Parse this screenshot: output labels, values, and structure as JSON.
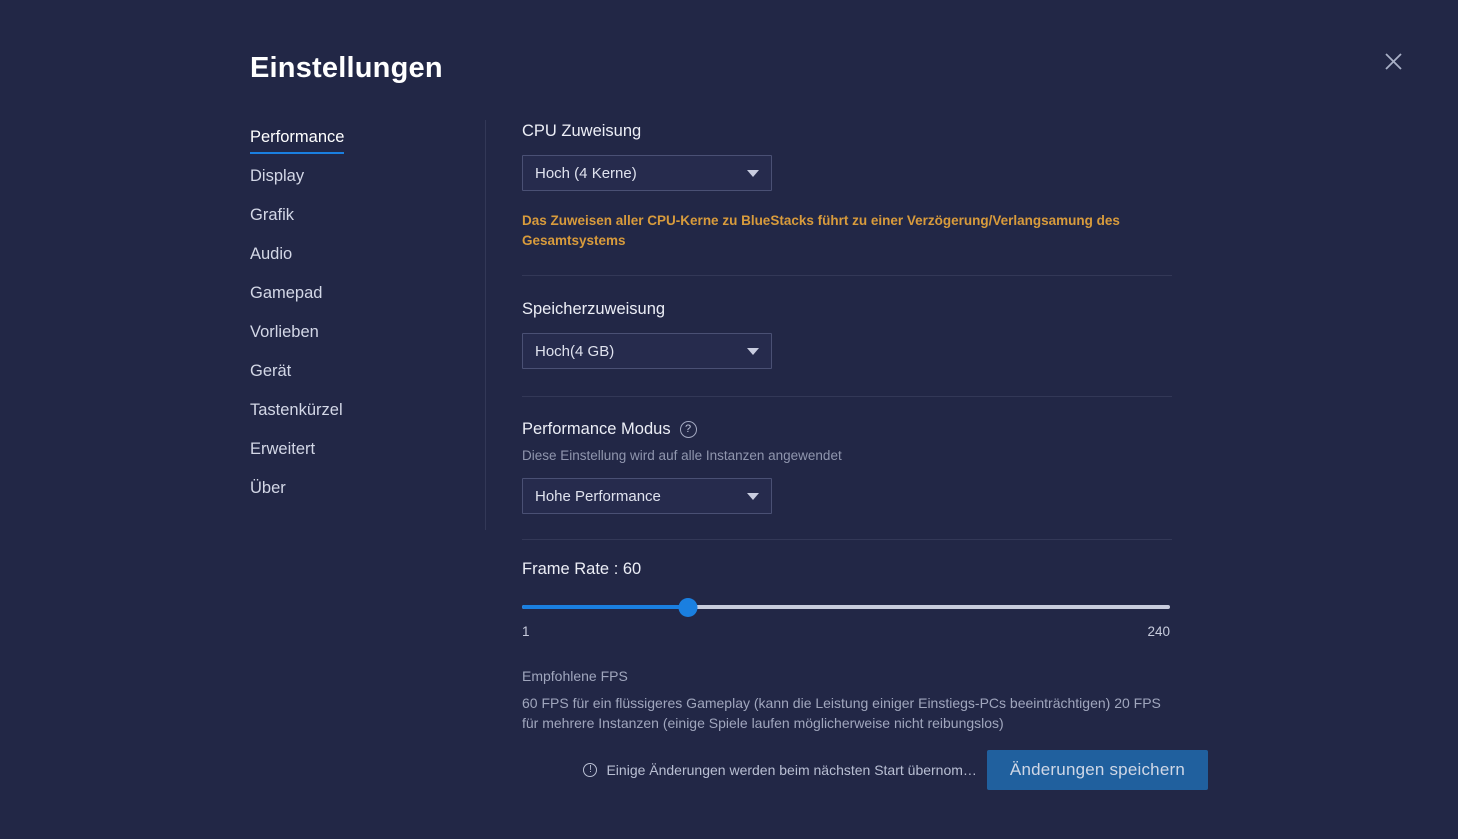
{
  "window": {
    "title": "Einstellungen",
    "close_icon": "close-icon"
  },
  "sidebar": {
    "items": [
      {
        "label": "Performance",
        "active": true
      },
      {
        "label": "Display",
        "active": false
      },
      {
        "label": "Grafik",
        "active": false
      },
      {
        "label": "Audio",
        "active": false
      },
      {
        "label": "Gamepad",
        "active": false
      },
      {
        "label": "Vorlieben",
        "active": false
      },
      {
        "label": "Gerät",
        "active": false
      },
      {
        "label": "Tastenkürzel",
        "active": false
      },
      {
        "label": "Erweitert",
        "active": false
      },
      {
        "label": "Über",
        "active": false
      }
    ]
  },
  "cpu": {
    "label": "CPU Zuweisung",
    "selected": "Hoch (4 Kerne)",
    "warning": "Das Zuweisen aller CPU-Kerne zu BlueStacks  führt zu einer Verzögerung/Verlangsamung des Gesamtsystems"
  },
  "memory": {
    "label": "Speicherzuweisung",
    "selected": "Hoch(4 GB)"
  },
  "performance_mode": {
    "label": "Performance Modus",
    "help_icon": "question-mark-icon",
    "subtitle": "Diese Einstellung wird auf alle Instanzen angewendet",
    "selected": "Hohe Performance"
  },
  "frame_rate": {
    "label": "Frame Rate : 60",
    "value": 60,
    "min_label": "1",
    "max_label": "240",
    "min": 1,
    "max": 240,
    "fill_percent": 25.6,
    "note_title": "Empfohlene FPS",
    "note_body": "60 FPS für ein flüssigeres Gameplay (kann die Leistung einiger Einstiegs-PCs beeinträchtigen) 20 FPS für mehrere Instanzen (einige Spiele laufen möglicherweise nicht reibungslos)"
  },
  "footer": {
    "info_icon": "info-icon",
    "note": "Einige Änderungen werden beim nächsten Start übernom…",
    "save_label": "Änderungen speichern"
  },
  "colors": {
    "background": "#222746",
    "accent": "#1a7fe0",
    "warning": "#d89b3c",
    "save_button": "#20609e",
    "divider": "#333857"
  }
}
